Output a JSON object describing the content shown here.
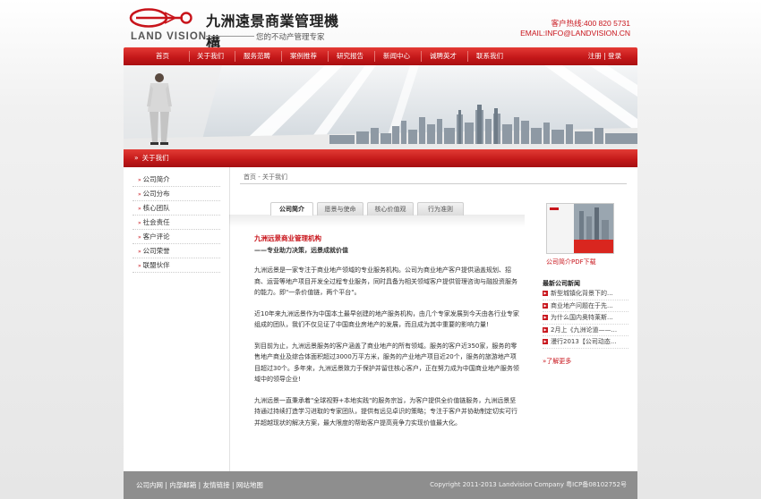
{
  "header": {
    "logo_cn": "九洲遠景商業管理機構",
    "logo_en": "LAND VISION",
    "tagline": "您的不动产管理专家",
    "hotline": "客户热线:400 820 5731",
    "email": "EMAIL:INFO@LANDVISION.CN"
  },
  "nav": {
    "items": [
      "首页",
      "关于我们",
      "服务范畴",
      "案例推荐",
      "研究报告",
      "新闻中心",
      "诚聘英才",
      "联系我们"
    ],
    "login": "注册 | 登录"
  },
  "section": {
    "title": "关于我们"
  },
  "sidebar": {
    "items": [
      "公司简介",
      "公司分布",
      "核心团队",
      "社会责任",
      "客户评论",
      "公司荣誉",
      "联盟伙伴"
    ]
  },
  "breadcrumb": "首页 - 关于我们",
  "tabs": [
    "公司简介",
    "愿景与使命",
    "核心价值观",
    "行为准则"
  ],
  "article": {
    "title": "九洲远景商业管理机构",
    "subtitle": "——专业助力决策，远景成就价值",
    "paragraphs": [
      "九洲远景是一家专注于商业地产领域的专业服务机构。公司为商业地产客户提供涵盖规划、招商、运营等地产项目开发全过程专业服务，同时具备为相关领域客户提供管理咨询与融投资服务的能力。即\"一条价值链，两个平台\"。",
      "近10年来九洲远景作为中国本土最早创建的地产服务机构，由几个专家发展到今天由各行业专家组成的团队，我们不仅见证了中国商业房地产的发展，而且成为其中重要的影响力量!",
      "到目前为止，九洲远景服务的客户涵盖了商业地产的所有领域。服务的客户近350家，服务的零售地产商业及综合体面积超过3000万平方米，服务的产业地产项目近20个，服务的旅游地产项目超过30个。多年来，九洲远景致力于保护并留住核心客户，正在努力成为中国商业地产服务领域中的领导企业!",
      "九洲远景一直秉承着\"全球视野+本地实践\"的服务宗旨，为客户提供全价值链服务，九洲远景坚持通过持续打造学习进取的专家团队，提供有远见卓识的策略；专注于客户并协助制定切实可行并超越现状的解决方案，最大限度的帮助客户提高竞争力实现价值最大化。"
    ]
  },
  "right": {
    "brochure_cover_text": "九洲远景商业管理机构",
    "brochure_link": "公司简介PDF下载",
    "news_title": "最新公司新闻",
    "news": [
      "新型城镇化背景下的...",
      "商业地产问题在于先...",
      "为什么国内奥特莱斯...",
      "2月上《九洲论道——...",
      "漫行2013【公司动态..."
    ],
    "more": "了解更多"
  },
  "footer": {
    "links": "公司内网 | 内部邮箱 | 友情链接 | 网站地图",
    "copyright": "Copyright 2011-2013 Landvision Company 粤ICP备08102752号"
  },
  "colors": {
    "brand_red": "#c8141b",
    "footer_gray": "#8e8e8e"
  }
}
